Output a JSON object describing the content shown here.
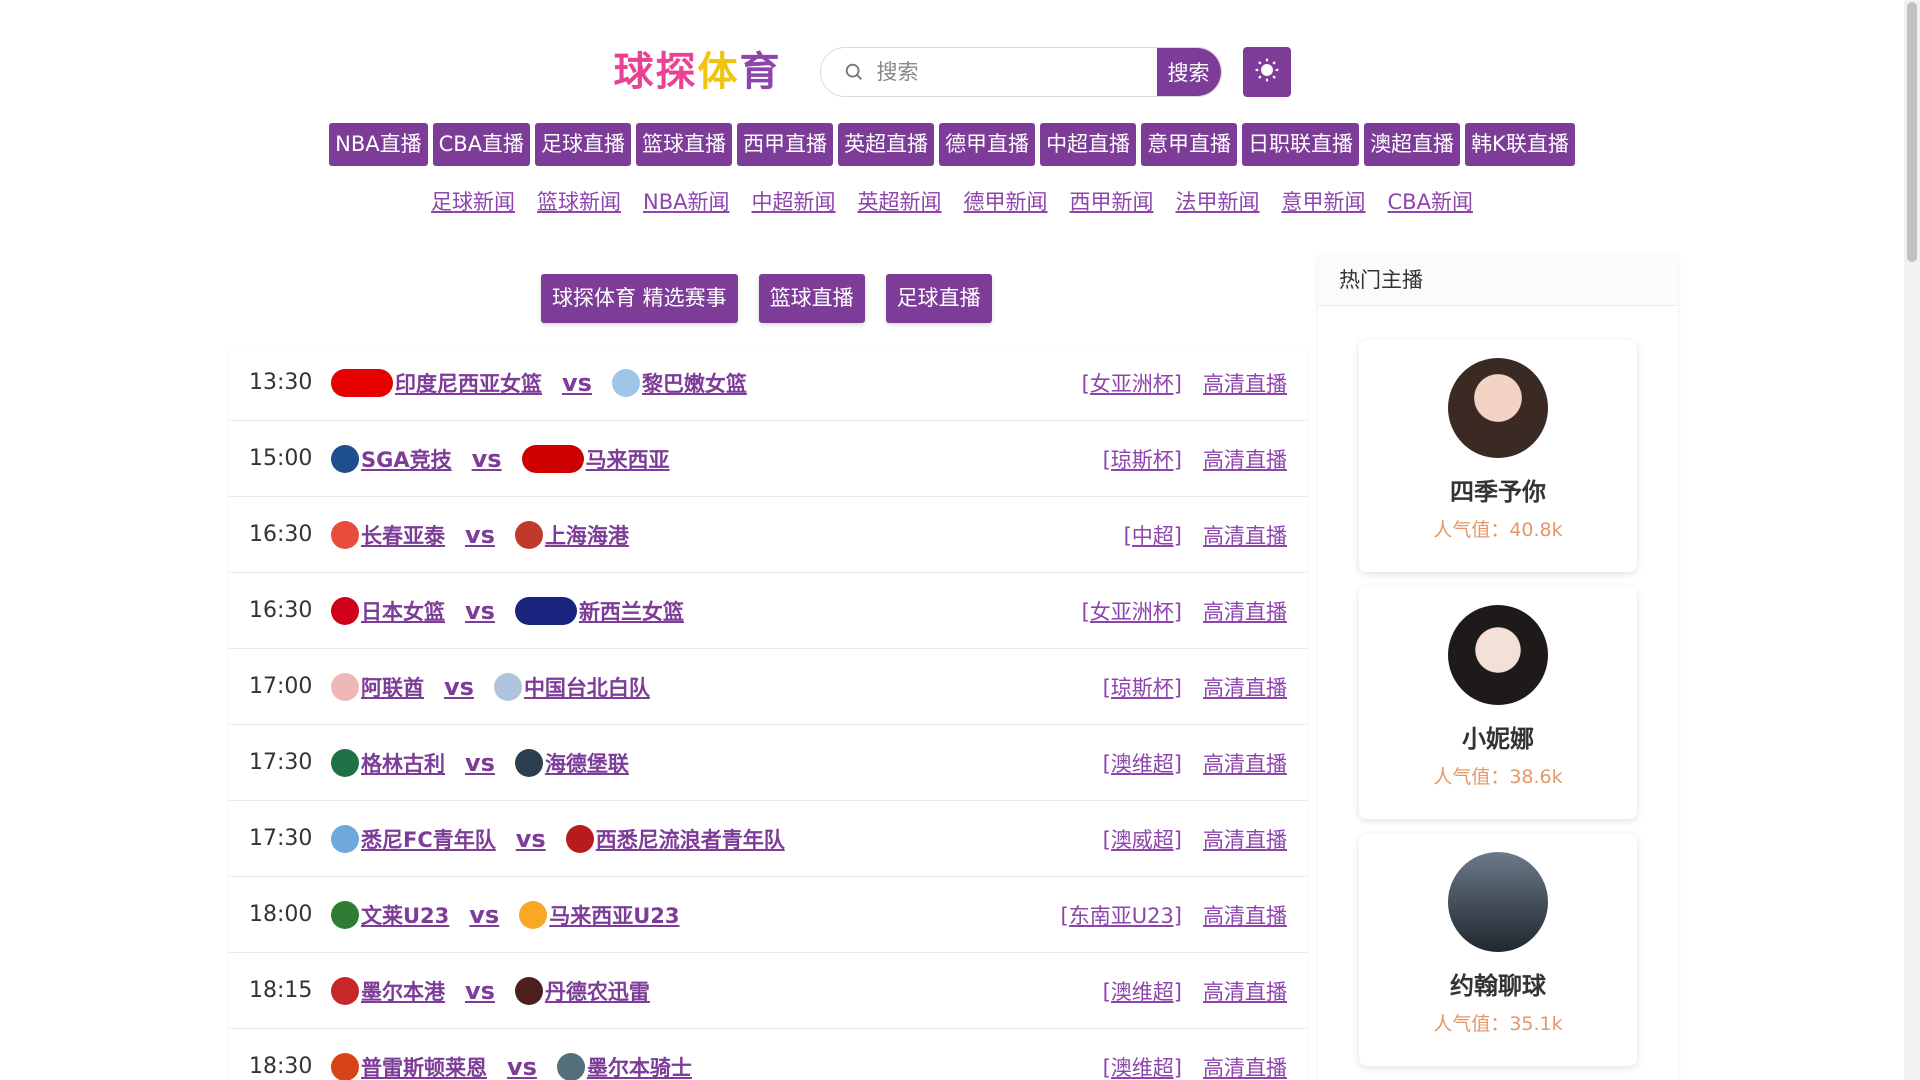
{
  "header": {
    "logo_chars": [
      "球",
      "探",
      "体",
      "育"
    ],
    "logo_colors": [
      "#e84393",
      "#e84393",
      "#f1c40f",
      "#8e44ad"
    ],
    "search_placeholder": "搜索",
    "search_button": "搜索",
    "theme_icon": "sun-icon"
  },
  "nav_live": [
    "NBA直播",
    "CBA直播",
    "足球直播",
    "篮球直播",
    "西甲直播",
    "英超直播",
    "德甲直播",
    "中超直播",
    "意甲直播",
    "日职联直播",
    "澳超直播",
    "韩K联直播"
  ],
  "nav_news": [
    "足球新闻",
    "篮球新闻",
    "NBA新闻",
    "中超新闻",
    "英超新闻",
    "德甲新闻",
    "西甲新闻",
    "法甲新闻",
    "意甲新闻",
    "CBA新闻"
  ],
  "tabs": [
    "球探体育 精选赛事",
    "篮球直播",
    "足球直播"
  ],
  "matches": [
    {
      "time": "13:30",
      "home": "印度尼西亚女篮",
      "away": "黎巴嫩女篮",
      "league": "[女亚洲杯]",
      "live": "高清直播",
      "home_color": "#e60000",
      "away_color": "#9ec6e8",
      "home_wide": true,
      "away_wide": false
    },
    {
      "time": "15:00",
      "home": "SGA竞技",
      "away": "马来西亚",
      "league": "[琼斯杯]",
      "live": "高清直播",
      "home_color": "#1f4e8c",
      "away_color": "#cc0001",
      "home_wide": false,
      "away_wide": true
    },
    {
      "time": "16:30",
      "home": "长春亚泰",
      "away": "上海海港",
      "league": "[中超]",
      "live": "高清直播",
      "home_color": "#e74c3c",
      "away_color": "#c0392b",
      "home_wide": false,
      "away_wide": false
    },
    {
      "time": "16:30",
      "home": "日本女篮",
      "away": "新西兰女篮",
      "league": "[女亚洲杯]",
      "live": "高清直播",
      "home_color": "#d0021b",
      "away_color": "#1a237e",
      "home_wide": false,
      "away_wide": true
    },
    {
      "time": "17:00",
      "home": "阿联酋",
      "away": "中国台北白队",
      "league": "[琼斯杯]",
      "live": "高清直播",
      "home_color": "#f0b7b7",
      "away_color": "#b0c4de",
      "home_wide": false,
      "away_wide": false
    },
    {
      "time": "17:30",
      "home": "格林古利",
      "away": "海德堡联",
      "league": "[澳维超]",
      "live": "高清直播",
      "home_color": "#1e7145",
      "away_color": "#2c3e50",
      "home_wide": false,
      "away_wide": false
    },
    {
      "time": "17:30",
      "home": "悉尼FC青年队",
      "away": "西悉尼流浪者青年队",
      "league": "[澳威超]",
      "live": "高清直播",
      "home_color": "#6fa8dc",
      "away_color": "#b71c1c",
      "home_wide": false,
      "away_wide": false
    },
    {
      "time": "18:00",
      "home": "文莱U23",
      "away": "马来西亚U23",
      "league": "[东南亚U23]",
      "live": "高清直播",
      "home_color": "#2e7d32",
      "away_color": "#f9a825",
      "home_wide": false,
      "away_wide": false
    },
    {
      "time": "18:15",
      "home": "墨尔本港",
      "away": "丹德农迅雷",
      "league": "[澳维超]",
      "live": "高清直播",
      "home_color": "#c62828",
      "away_color": "#4e1f1f",
      "home_wide": false,
      "away_wide": false
    },
    {
      "time": "18:30",
      "home": "普雷斯顿莱恩",
      "away": "墨尔本骑士",
      "league": "[澳维超]",
      "live": "高清直播",
      "home_color": "#d84315",
      "away_color": "#546e7a",
      "home_wide": false,
      "away_wide": false
    }
  ],
  "sidebar": {
    "title": "热门主播",
    "anchors": [
      {
        "name": "四季予你",
        "popularity": "人气值：40.8k"
      },
      {
        "name": "小妮娜",
        "popularity": "人气值：38.6k"
      },
      {
        "name": "约翰聊球",
        "popularity": "人气值：35.1k"
      }
    ]
  },
  "colors": {
    "accent": "#7d3c98",
    "link": "#8e44ad",
    "popularity": "#e59866"
  }
}
